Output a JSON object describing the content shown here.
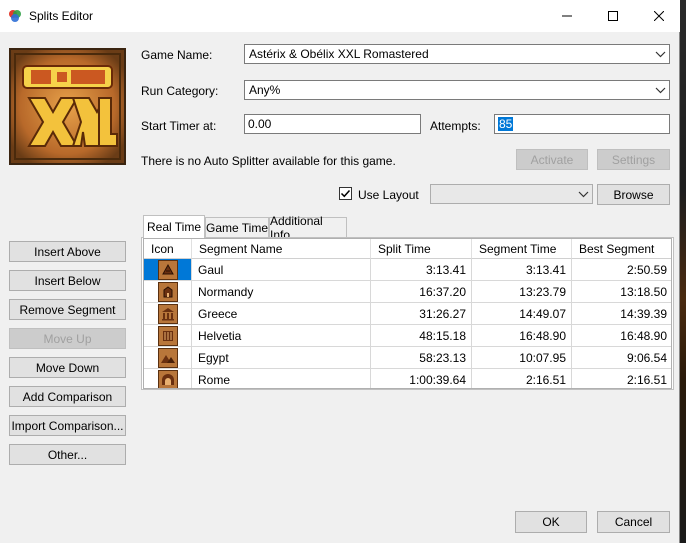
{
  "window": {
    "title": "Splits Editor",
    "icons": {
      "app": "livesplit-icon",
      "minimize": "minimize-icon",
      "maximize": "maximize-icon",
      "close": "close-icon"
    }
  },
  "logo": {
    "name": "asterix-obelix-xxl-logo"
  },
  "form": {
    "game_name_label": "Game Name:",
    "game_name_value": "Astérix & Obélix XXL Romastered",
    "run_category_label": "Run Category:",
    "run_category_value": "Any%",
    "start_timer_label": "Start Timer at:",
    "start_timer_value": "0.00",
    "attempts_label": "Attempts:",
    "attempts_value": "85",
    "auto_splitter_text": "There is no Auto Splitter available for this game.",
    "activate_label": "Activate",
    "settings_label": "Settings",
    "use_layout_label": "Use Layout",
    "use_layout_checked": true,
    "layout_value": "",
    "browse_label": "Browse"
  },
  "tabs": [
    {
      "label": "Real Time",
      "active": true
    },
    {
      "label": "Game Time",
      "active": false
    },
    {
      "label": "Additional Info",
      "active": false
    }
  ],
  "table": {
    "columns": [
      "Icon",
      "Segment Name",
      "Split Time",
      "Segment Time",
      "Best Segment"
    ],
    "rows": [
      {
        "icon": "gaul-icon",
        "name": "Gaul",
        "split": "3:13.41",
        "segment": "3:13.41",
        "best": "2:50.59",
        "selected": true
      },
      {
        "icon": "normandy-icon",
        "name": "Normandy",
        "split": "16:37.20",
        "segment": "13:23.79",
        "best": "13:18.50"
      },
      {
        "icon": "greece-icon",
        "name": "Greece",
        "split": "31:26.27",
        "segment": "14:49.07",
        "best": "14:39.39"
      },
      {
        "icon": "helvetia-icon",
        "name": "Helvetia",
        "split": "48:15.18",
        "segment": "16:48.90",
        "best": "16:48.90"
      },
      {
        "icon": "egypt-icon",
        "name": "Egypt",
        "split": "58:23.13",
        "segment": "10:07.95",
        "best": "9:06.54"
      },
      {
        "icon": "rome-icon",
        "name": "Rome",
        "split": "1:00:39.64",
        "segment": "2:16.51",
        "best": "2:16.51"
      }
    ]
  },
  "side_buttons": {
    "insert_above": "Insert Above",
    "insert_below": "Insert Below",
    "remove_segment": "Remove Segment",
    "move_up": "Move Up",
    "move_down": "Move Down",
    "add_comparison": "Add Comparison",
    "import_comparison": "Import Comparison...",
    "other": "Other..."
  },
  "footer": {
    "ok_label": "OK",
    "cancel_label": "Cancel"
  },
  "colors": {
    "selection": "#0078d7",
    "window_bg": "#f0f0f0",
    "button_bg": "#e1e1e1"
  }
}
